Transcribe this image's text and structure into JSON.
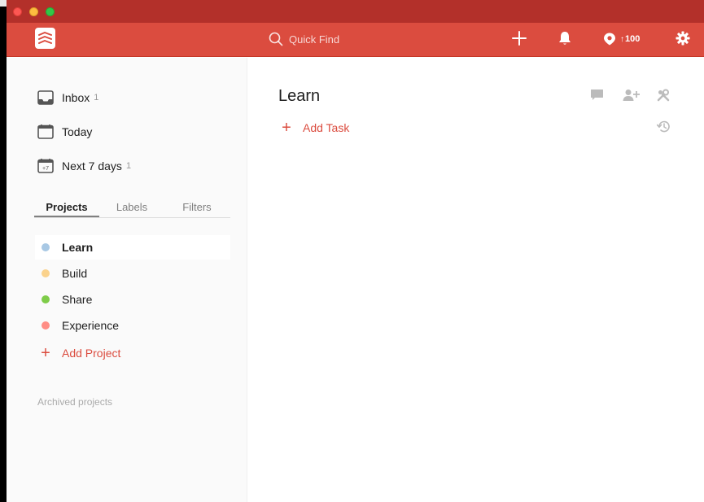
{
  "colors": {
    "brand": "#db4c3f",
    "titlebar": "#b3302a",
    "sidebar_bg": "#fafafa",
    "text": "#202020",
    "muted": "#808080"
  },
  "topbar": {
    "logo_icon": "todoist-logo-icon",
    "search_placeholder": "Quick Find",
    "karma_arrow": "↑",
    "karma_value": "100"
  },
  "sidebar": {
    "nav": [
      {
        "label": "Inbox",
        "count": "1",
        "icon": "inbox-icon"
      },
      {
        "label": "Today",
        "count": "",
        "icon": "calendar-icon"
      },
      {
        "label": "Next 7 days",
        "count": "1",
        "icon": "calendar-plus7-icon",
        "icon_text": "+7"
      }
    ],
    "tabs": [
      "Projects",
      "Labels",
      "Filters"
    ],
    "active_tab": "Projects",
    "projects": [
      {
        "label": "Learn",
        "color": "#a8c8e4",
        "selected": true
      },
      {
        "label": "Build",
        "color": "#fad28c",
        "selected": false
      },
      {
        "label": "Share",
        "color": "#7ecc49",
        "selected": false
      },
      {
        "label": "Experience",
        "color": "#ff8d85",
        "selected": false
      }
    ],
    "add_project_label": "Add Project",
    "archived_label": "Archived projects"
  },
  "main": {
    "title": "Learn",
    "add_task_label": "Add Task"
  }
}
